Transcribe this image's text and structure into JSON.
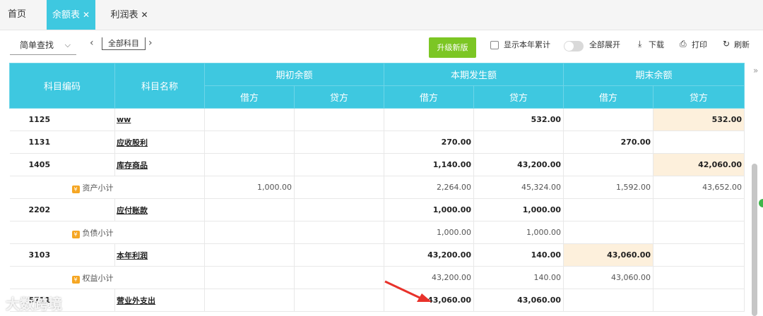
{
  "tabs": [
    {
      "label": "首页",
      "closable": false,
      "active": false
    },
    {
      "label": "余额表",
      "closable": true,
      "active": true
    },
    {
      "label": "利润表",
      "closable": true,
      "active": false
    }
  ],
  "toolbar": {
    "search_mode": "简单查找",
    "subject_scope": "全部科目",
    "upgrade_label": "升级新版",
    "show_year_total_label": "显示本年累计",
    "expand_all_label": "全部展开",
    "download_label": "下载",
    "print_label": "打印",
    "refresh_label": "刷新"
  },
  "table": {
    "headers": {
      "code": "科目编码",
      "name": "科目名称",
      "opening": "期初余额",
      "current": "本期发生额",
      "closing": "期末余额",
      "debit": "借方",
      "credit": "贷方"
    },
    "rows": [
      {
        "type": "detail",
        "code": "1125",
        "name": "ww",
        "od": "",
        "oc": "",
        "cd": "",
        "cc": "532.00",
        "ed": "",
        "ec": "532.00",
        "hl": "ec"
      },
      {
        "type": "detail",
        "code": "1131",
        "name": "应收股利",
        "od": "",
        "oc": "",
        "cd": "270.00",
        "cc": "",
        "ed": "270.00",
        "ec": "",
        "hl": ""
      },
      {
        "type": "detail",
        "code": "1405",
        "name": "库存商品",
        "od": "",
        "oc": "",
        "cd": "1,140.00",
        "cc": "43,200.00",
        "ed": "",
        "ec": "42,060.00",
        "hl": "ec"
      },
      {
        "type": "subtotal",
        "label": "资产小计",
        "od": "1,000.00",
        "oc": "",
        "cd": "2,264.00",
        "cc": "45,324.00",
        "ed": "1,592.00",
        "ec": "43,652.00"
      },
      {
        "type": "detail",
        "code": "2202",
        "name": "应付账款",
        "od": "",
        "oc": "",
        "cd": "1,000.00",
        "cc": "1,000.00",
        "ed": "",
        "ec": "",
        "hl": ""
      },
      {
        "type": "subtotal",
        "label": "负债小计",
        "od": "",
        "oc": "",
        "cd": "1,000.00",
        "cc": "1,000.00",
        "ed": "",
        "ec": ""
      },
      {
        "type": "detail",
        "code": "3103",
        "name": "本年利润",
        "od": "",
        "oc": "",
        "cd": "43,200.00",
        "cc": "140.00",
        "ed": "43,060.00",
        "ec": "",
        "hl": "ed"
      },
      {
        "type": "subtotal",
        "label": "权益小计",
        "od": "",
        "oc": "",
        "cd": "43,200.00",
        "cc": "140.00",
        "ed": "43,060.00",
        "ec": ""
      },
      {
        "type": "detail",
        "code": "5711",
        "name": "营业外支出",
        "od": "",
        "oc": "",
        "cd": "43,060.00",
        "cc": "43,060.00",
        "ed": "",
        "ec": "",
        "hl": ""
      }
    ]
  },
  "watermark": "大数跨境",
  "colors": {
    "header_bg": "#3ec8e0",
    "upgrade_btn": "#7cc624",
    "highlight": "#fdf0dc",
    "annotation_arrow": "#e8322b"
  }
}
